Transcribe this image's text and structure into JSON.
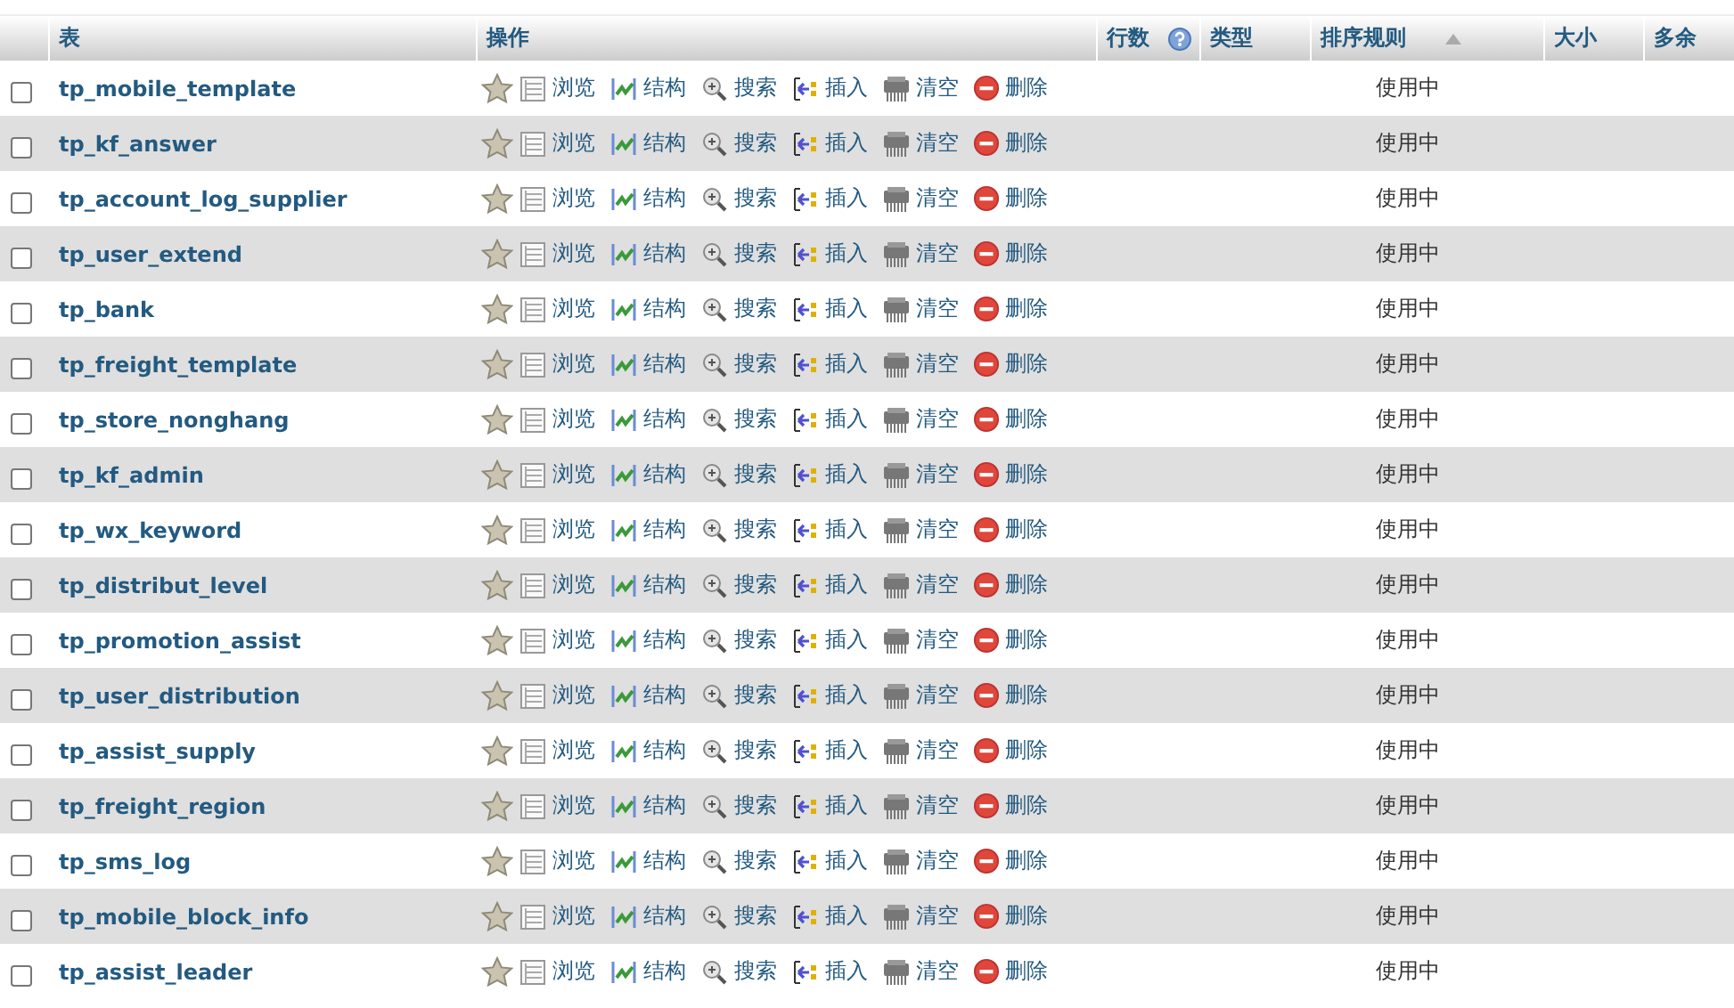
{
  "columns": [
    {
      "label": "表"
    },
    {
      "label": "操作"
    },
    {
      "label": "行数",
      "help": true
    },
    {
      "label": "类型"
    },
    {
      "label": "排序规则",
      "sorted": true
    },
    {
      "label": "大小"
    },
    {
      "label": "多余"
    }
  ],
  "rows": [
    {
      "name": "tp_mobile_template",
      "checked": false,
      "status": "使用中",
      "actions": [
        {
          "kind": "browse",
          "label": "浏览"
        },
        {
          "kind": "structure",
          "label": "结构"
        },
        {
          "kind": "search",
          "label": "搜索"
        },
        {
          "kind": "insert",
          "label": "插入"
        },
        {
          "kind": "empty",
          "label": "清空"
        },
        {
          "kind": "drop",
          "label": "删除"
        }
      ]
    },
    {
      "name": "tp_kf_answer",
      "checked": false,
      "status": "使用中",
      "actions": [
        {
          "kind": "browse",
          "label": "浏览"
        },
        {
          "kind": "structure",
          "label": "结构"
        },
        {
          "kind": "search",
          "label": "搜索"
        },
        {
          "kind": "insert",
          "label": "插入"
        },
        {
          "kind": "empty",
          "label": "清空"
        },
        {
          "kind": "drop",
          "label": "删除"
        }
      ]
    },
    {
      "name": "tp_account_log_supplier",
      "checked": false,
      "status": "使用中",
      "actions": [
        {
          "kind": "browse",
          "label": "浏览"
        },
        {
          "kind": "structure",
          "label": "结构"
        },
        {
          "kind": "search",
          "label": "搜索"
        },
        {
          "kind": "insert",
          "label": "插入"
        },
        {
          "kind": "empty",
          "label": "清空"
        },
        {
          "kind": "drop",
          "label": "删除"
        }
      ]
    },
    {
      "name": "tp_user_extend",
      "checked": false,
      "status": "使用中",
      "actions": [
        {
          "kind": "browse",
          "label": "浏览"
        },
        {
          "kind": "structure",
          "label": "结构"
        },
        {
          "kind": "search",
          "label": "搜索"
        },
        {
          "kind": "insert",
          "label": "插入"
        },
        {
          "kind": "empty",
          "label": "清空"
        },
        {
          "kind": "drop",
          "label": "删除"
        }
      ]
    },
    {
      "name": "tp_bank",
      "checked": false,
      "status": "使用中",
      "actions": [
        {
          "kind": "browse",
          "label": "浏览"
        },
        {
          "kind": "structure",
          "label": "结构"
        },
        {
          "kind": "search",
          "label": "搜索"
        },
        {
          "kind": "insert",
          "label": "插入"
        },
        {
          "kind": "empty",
          "label": "清空"
        },
        {
          "kind": "drop",
          "label": "删除"
        }
      ]
    },
    {
      "name": "tp_freight_template",
      "checked": false,
      "status": "使用中",
      "actions": [
        {
          "kind": "browse",
          "label": "浏览"
        },
        {
          "kind": "structure",
          "label": "结构"
        },
        {
          "kind": "search",
          "label": "搜索"
        },
        {
          "kind": "insert",
          "label": "插入"
        },
        {
          "kind": "empty",
          "label": "清空"
        },
        {
          "kind": "drop",
          "label": "删除"
        }
      ]
    },
    {
      "name": "tp_store_nonghang",
      "checked": false,
      "status": "使用中",
      "actions": [
        {
          "kind": "browse",
          "label": "浏览"
        },
        {
          "kind": "structure",
          "label": "结构"
        },
        {
          "kind": "search",
          "label": "搜索"
        },
        {
          "kind": "insert",
          "label": "插入"
        },
        {
          "kind": "empty",
          "label": "清空"
        },
        {
          "kind": "drop",
          "label": "删除"
        }
      ]
    },
    {
      "name": "tp_kf_admin",
      "checked": false,
      "status": "使用中",
      "actions": [
        {
          "kind": "browse",
          "label": "浏览"
        },
        {
          "kind": "structure",
          "label": "结构"
        },
        {
          "kind": "search",
          "label": "搜索"
        },
        {
          "kind": "insert",
          "label": "插入"
        },
        {
          "kind": "empty",
          "label": "清空"
        },
        {
          "kind": "drop",
          "label": "删除"
        }
      ]
    },
    {
      "name": "tp_wx_keyword",
      "checked": false,
      "status": "使用中",
      "actions": [
        {
          "kind": "browse",
          "label": "浏览"
        },
        {
          "kind": "structure",
          "label": "结构"
        },
        {
          "kind": "search",
          "label": "搜索"
        },
        {
          "kind": "insert",
          "label": "插入"
        },
        {
          "kind": "empty",
          "label": "清空"
        },
        {
          "kind": "drop",
          "label": "删除"
        }
      ]
    },
    {
      "name": "tp_distribut_level",
      "checked": false,
      "status": "使用中",
      "actions": [
        {
          "kind": "browse",
          "label": "浏览"
        },
        {
          "kind": "structure",
          "label": "结构"
        },
        {
          "kind": "search",
          "label": "搜索"
        },
        {
          "kind": "insert",
          "label": "插入"
        },
        {
          "kind": "empty",
          "label": "清空"
        },
        {
          "kind": "drop",
          "label": "删除"
        }
      ]
    },
    {
      "name": "tp_promotion_assist",
      "checked": false,
      "status": "使用中",
      "actions": [
        {
          "kind": "browse",
          "label": "浏览"
        },
        {
          "kind": "structure",
          "label": "结构"
        },
        {
          "kind": "search",
          "label": "搜索"
        },
        {
          "kind": "insert",
          "label": "插入"
        },
        {
          "kind": "empty",
          "label": "清空"
        },
        {
          "kind": "drop",
          "label": "删除"
        }
      ]
    },
    {
      "name": "tp_user_distribution",
      "checked": false,
      "status": "使用中",
      "actions": [
        {
          "kind": "browse",
          "label": "浏览"
        },
        {
          "kind": "structure",
          "label": "结构"
        },
        {
          "kind": "search",
          "label": "搜索"
        },
        {
          "kind": "insert",
          "label": "插入"
        },
        {
          "kind": "empty",
          "label": "清空"
        },
        {
          "kind": "drop",
          "label": "删除"
        }
      ]
    },
    {
      "name": "tp_assist_supply",
      "checked": false,
      "status": "使用中",
      "actions": [
        {
          "kind": "browse",
          "label": "浏览"
        },
        {
          "kind": "structure",
          "label": "结构"
        },
        {
          "kind": "search",
          "label": "搜索"
        },
        {
          "kind": "insert",
          "label": "插入"
        },
        {
          "kind": "empty",
          "label": "清空"
        },
        {
          "kind": "drop",
          "label": "删除"
        }
      ]
    },
    {
      "name": "tp_freight_region",
      "checked": false,
      "status": "使用中",
      "actions": [
        {
          "kind": "browse",
          "label": "浏览"
        },
        {
          "kind": "structure",
          "label": "结构"
        },
        {
          "kind": "search",
          "label": "搜索"
        },
        {
          "kind": "insert",
          "label": "插入"
        },
        {
          "kind": "empty",
          "label": "清空"
        },
        {
          "kind": "drop",
          "label": "删除"
        }
      ]
    },
    {
      "name": "tp_sms_log",
      "checked": false,
      "status": "使用中",
      "actions": [
        {
          "kind": "browse",
          "label": "浏览"
        },
        {
          "kind": "structure",
          "label": "结构"
        },
        {
          "kind": "search",
          "label": "搜索"
        },
        {
          "kind": "insert",
          "label": "插入"
        },
        {
          "kind": "empty",
          "label": "清空"
        },
        {
          "kind": "drop",
          "label": "删除"
        }
      ]
    },
    {
      "name": "tp_mobile_block_info",
      "checked": false,
      "status": "使用中",
      "actions": [
        {
          "kind": "browse",
          "label": "浏览"
        },
        {
          "kind": "structure",
          "label": "结构"
        },
        {
          "kind": "search",
          "label": "搜索"
        },
        {
          "kind": "insert",
          "label": "插入"
        },
        {
          "kind": "empty",
          "label": "清空"
        },
        {
          "kind": "drop",
          "label": "删除"
        }
      ]
    },
    {
      "name": "tp_assist_leader",
      "checked": false,
      "status": "使用中",
      "actions": [
        {
          "kind": "browse",
          "label": "浏览"
        },
        {
          "kind": "structure",
          "label": "结构"
        },
        {
          "kind": "search",
          "label": "搜索"
        },
        {
          "kind": "insert",
          "label": "插入"
        },
        {
          "kind": "empty",
          "label": "清空"
        },
        {
          "kind": "drop",
          "label": "删除"
        }
      ]
    }
  ]
}
